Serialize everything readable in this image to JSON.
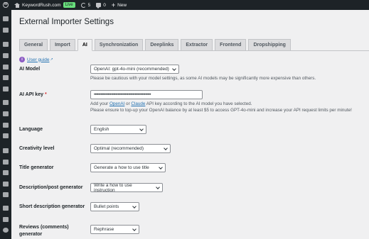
{
  "adminbar": {
    "site_name": "KeywordRush.com",
    "live_label": "Live",
    "updates_count": "5",
    "comments_count": "0",
    "new_label": "New"
  },
  "page": {
    "title": "External Importer Settings"
  },
  "tabs": [
    {
      "label": "General"
    },
    {
      "label": "Import"
    },
    {
      "label": "AI"
    },
    {
      "label": "Synchronization"
    },
    {
      "label": "Deeplinks"
    },
    {
      "label": "Extractor"
    },
    {
      "label": "Frontend"
    },
    {
      "label": "Dropshipping"
    }
  ],
  "active_tab": "AI",
  "guide": {
    "label": "User guide"
  },
  "fields": {
    "ai_model": {
      "label": "AI Model",
      "value": "OpenAI: gpt-4o-mini (recommended)",
      "description": "Please be cautious with your model settings, as some AI models may be significantly more expensive than others."
    },
    "api_key": {
      "label": "AI API key",
      "required_mark": "*",
      "value": "••••••••••••••••••••••••••••••••••••••••••••••••••",
      "desc_prefix": "Add your ",
      "link_openai": "OpenAI",
      "desc_or": " or ",
      "link_claude": "Claude",
      "desc_suffix": " API key according to the AI model you have selected.",
      "description2": "Please ensure to top-up your OpenAI balance by at least $5 to access GPT-4o-mini and increase your API request limits per minute!"
    },
    "language": {
      "label": "Language",
      "value": "English"
    },
    "creativity": {
      "label": "Creativity level",
      "value": "Optimal (recommended)"
    },
    "title_generator": {
      "label": "Title generator",
      "value": "Generate a how to use title"
    },
    "description_generator": {
      "label": "Description/post generator",
      "value": "Write a how to use instruction"
    },
    "short_description_generator": {
      "label": "Short description generator",
      "value": "Bullet points"
    },
    "reviews_generator": {
      "label": "Reviews (comments) generator",
      "value": "Rephrase"
    }
  }
}
